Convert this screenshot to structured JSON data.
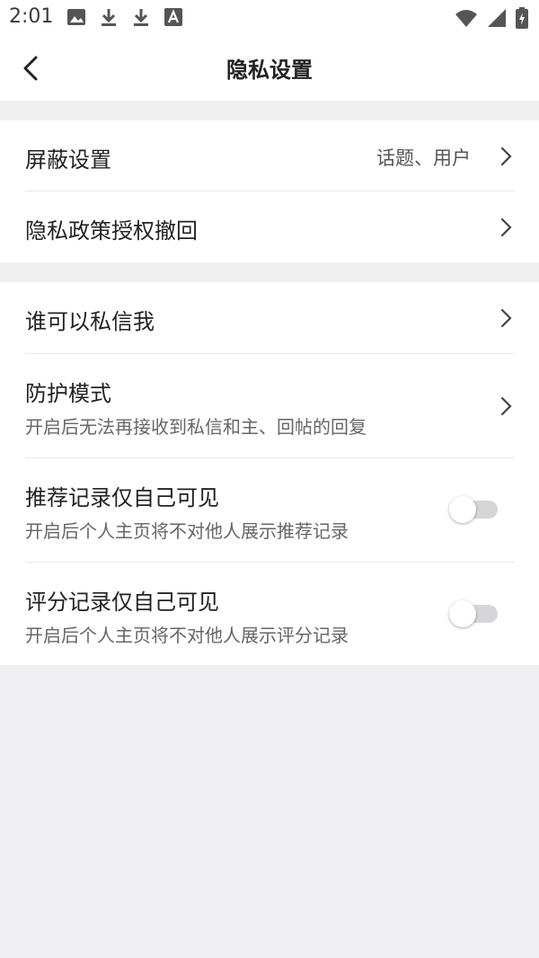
{
  "status_bar": {
    "time": "2:01",
    "left_icons": [
      "image-icon",
      "download-icon",
      "download-icon",
      "font-icon"
    ],
    "right_icons": [
      "wifi-icon",
      "cellular-signal-icon",
      "battery-icon"
    ]
  },
  "header": {
    "title": "隐私设置",
    "back_icon": "back-arrow-icon"
  },
  "section1": {
    "items": [
      {
        "title": "屏蔽设置",
        "value": "话题、用户"
      },
      {
        "title": "隐私政策授权撤回"
      }
    ]
  },
  "section2": {
    "items": [
      {
        "title": "谁可以私信我"
      },
      {
        "title": "防护模式",
        "subtitle": "开启后无法再接收到私信和主、回帖的回复"
      },
      {
        "title": "推荐记录仅自己可见",
        "subtitle": "开启后个人主页将不对他人展示推荐记录",
        "toggle_on": false
      },
      {
        "title": "评分记录仅自己可见",
        "subtitle": "开启后个人主页将不对他人展示评分记录",
        "toggle_on": false
      }
    ]
  },
  "colors": {
    "background": "#f0f0f3",
    "surface": "#ffffff",
    "text_primary": "#222222",
    "text_secondary": "#666666",
    "toggle_track_off": "#d6d6d8"
  }
}
